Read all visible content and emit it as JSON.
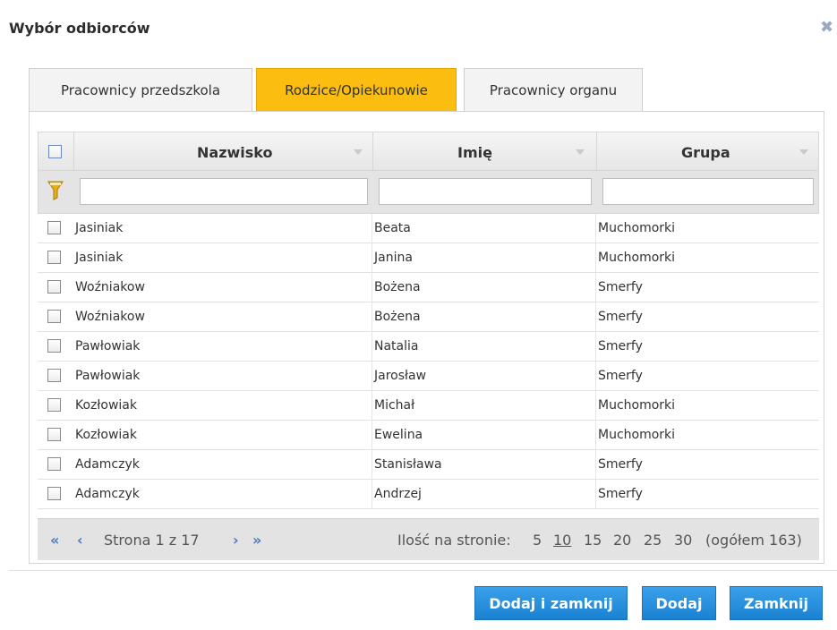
{
  "dialog": {
    "title": "Wybór odbiorców",
    "close_icon": "close-icon"
  },
  "tabs": [
    {
      "label": "Pracownicy przedszkola",
      "active": false
    },
    {
      "label": "Rodzice/Opiekunowie",
      "active": true
    },
    {
      "label": "Pracownicy organu",
      "active": false
    }
  ],
  "grid": {
    "columns": [
      "Nazwisko",
      "Imię",
      "Grupa"
    ],
    "filter_values": [
      "",
      "",
      ""
    ],
    "rows": [
      {
        "nazwisko": "Jasiniak",
        "imie": "Beata",
        "grupa": "Muchomorki",
        "checked": false
      },
      {
        "nazwisko": "Jasiniak",
        "imie": "Janina",
        "grupa": "Muchomorki",
        "checked": false
      },
      {
        "nazwisko": "Woźniakow",
        "imie": "Bożena",
        "grupa": "Smerfy",
        "checked": false
      },
      {
        "nazwisko": "Woźniakow",
        "imie": "Bożena",
        "grupa": "Smerfy",
        "checked": false
      },
      {
        "nazwisko": "Pawłowiak",
        "imie": "Natalia",
        "grupa": "Smerfy",
        "checked": false
      },
      {
        "nazwisko": "Pawłowiak",
        "imie": "Jarosław",
        "grupa": "Smerfy",
        "checked": false
      },
      {
        "nazwisko": "Kozłowiak",
        "imie": "Michał",
        "grupa": "Muchomorki",
        "checked": false
      },
      {
        "nazwisko": "Kozłowiak",
        "imie": "Ewelina",
        "grupa": "Muchomorki",
        "checked": false
      },
      {
        "nazwisko": "Adamczyk",
        "imie": "Stanisława",
        "grupa": "Smerfy",
        "checked": false
      },
      {
        "nazwisko": "Adamczyk",
        "imie": "Andrzej",
        "grupa": "Smerfy",
        "checked": false
      }
    ]
  },
  "pager": {
    "first": "«",
    "prev": "‹",
    "next": "›",
    "last": "»",
    "page_text": "Strona 1 z 17",
    "per_page_label": "Ilość na stronie:",
    "per_page_options": [
      "5",
      "10",
      "15",
      "20",
      "25",
      "30"
    ],
    "per_page_selected": "10",
    "total": "(ogółem 163)"
  },
  "buttons": {
    "add_close": "Dodaj i zamknij",
    "add": "Dodaj",
    "close": "Zamknij"
  },
  "colors": {
    "tab_active": "#fbbd0f",
    "button": "#1a82d2"
  }
}
